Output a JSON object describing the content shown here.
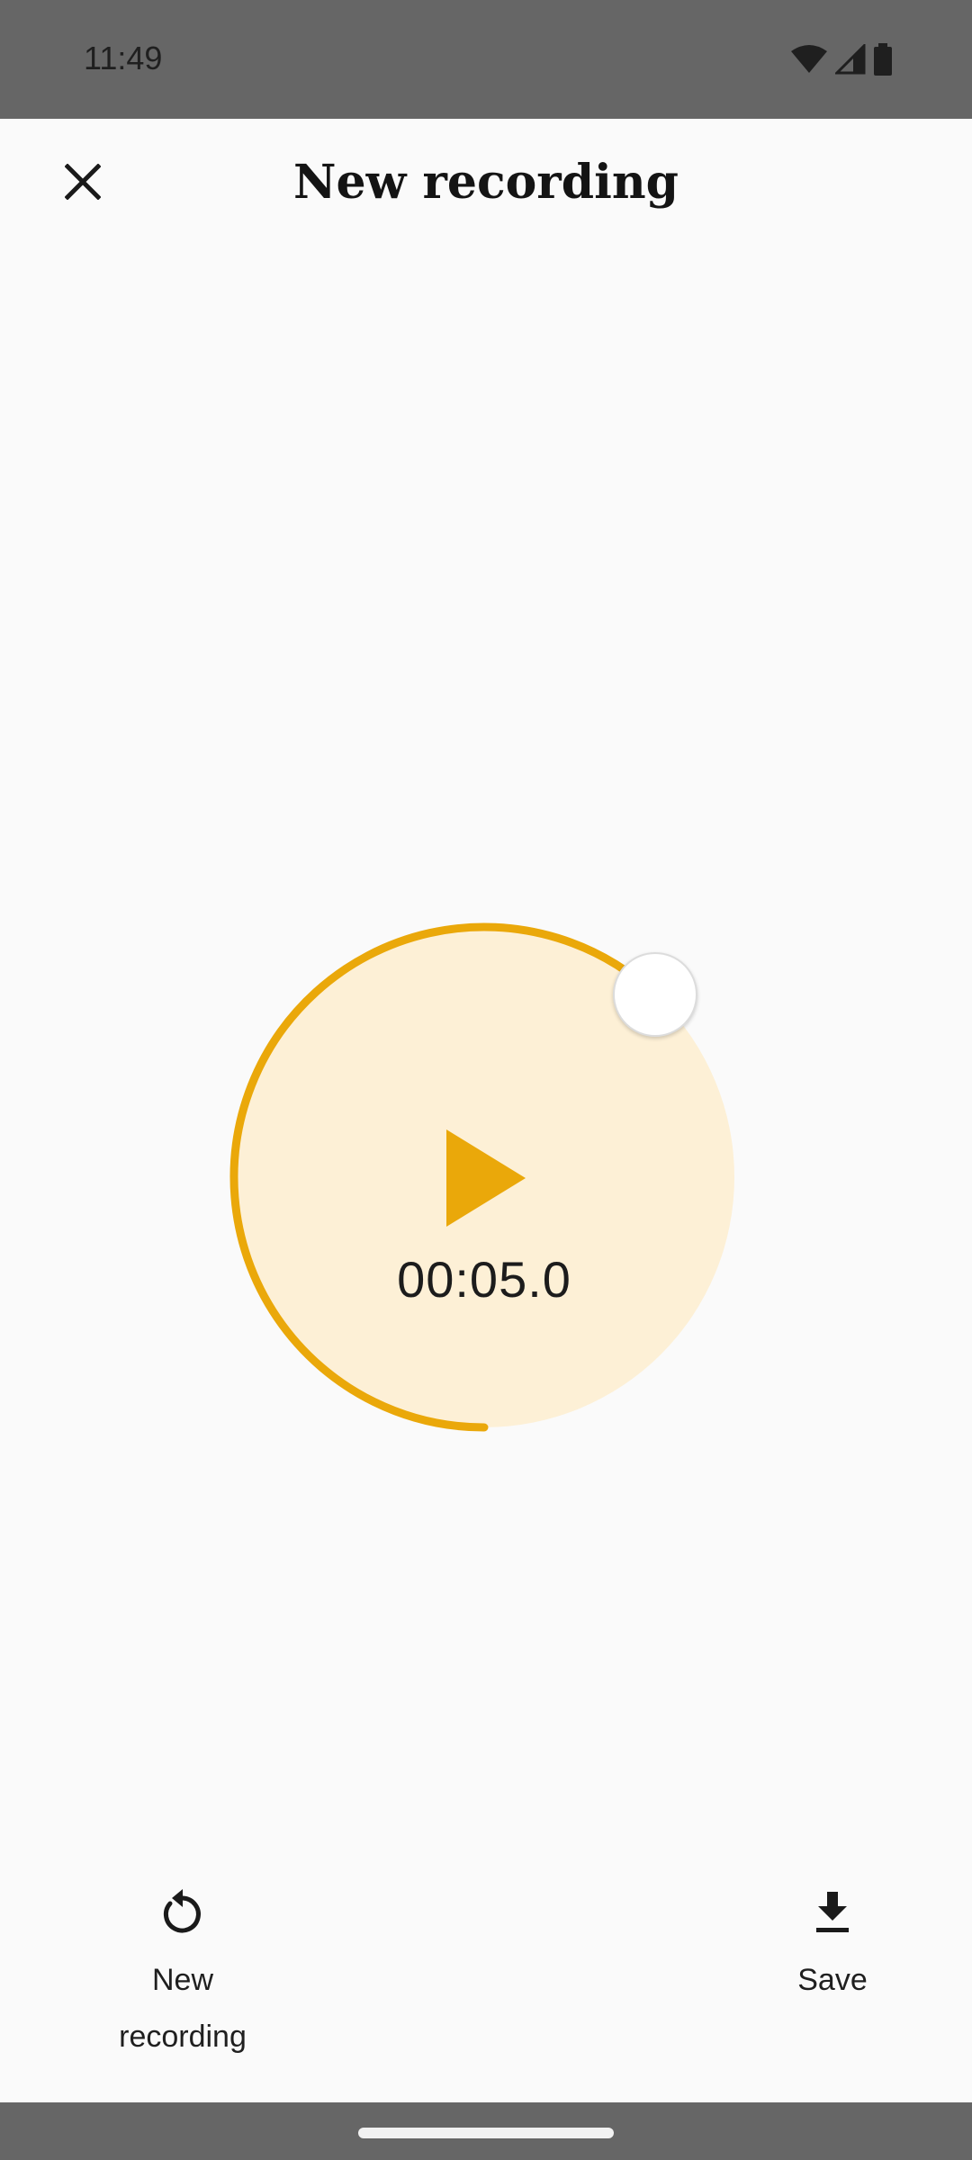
{
  "status_bar": {
    "time": "11:49",
    "icons": [
      "wifi-icon",
      "cell-signal-icon",
      "battery-icon"
    ]
  },
  "app_bar": {
    "title": "New recording",
    "close_icon": "close-icon"
  },
  "player": {
    "time": "00:05.0",
    "play_icon": "play-icon",
    "progress_fraction": 0.62,
    "colors": {
      "accent": "#eaa80a",
      "fill": "#fdf0d6"
    }
  },
  "actions": {
    "new_recording": {
      "icon": "reset-icon",
      "label_line1": "New",
      "label_line2": "recording"
    },
    "save": {
      "icon": "download-icon",
      "label": "Save"
    }
  }
}
